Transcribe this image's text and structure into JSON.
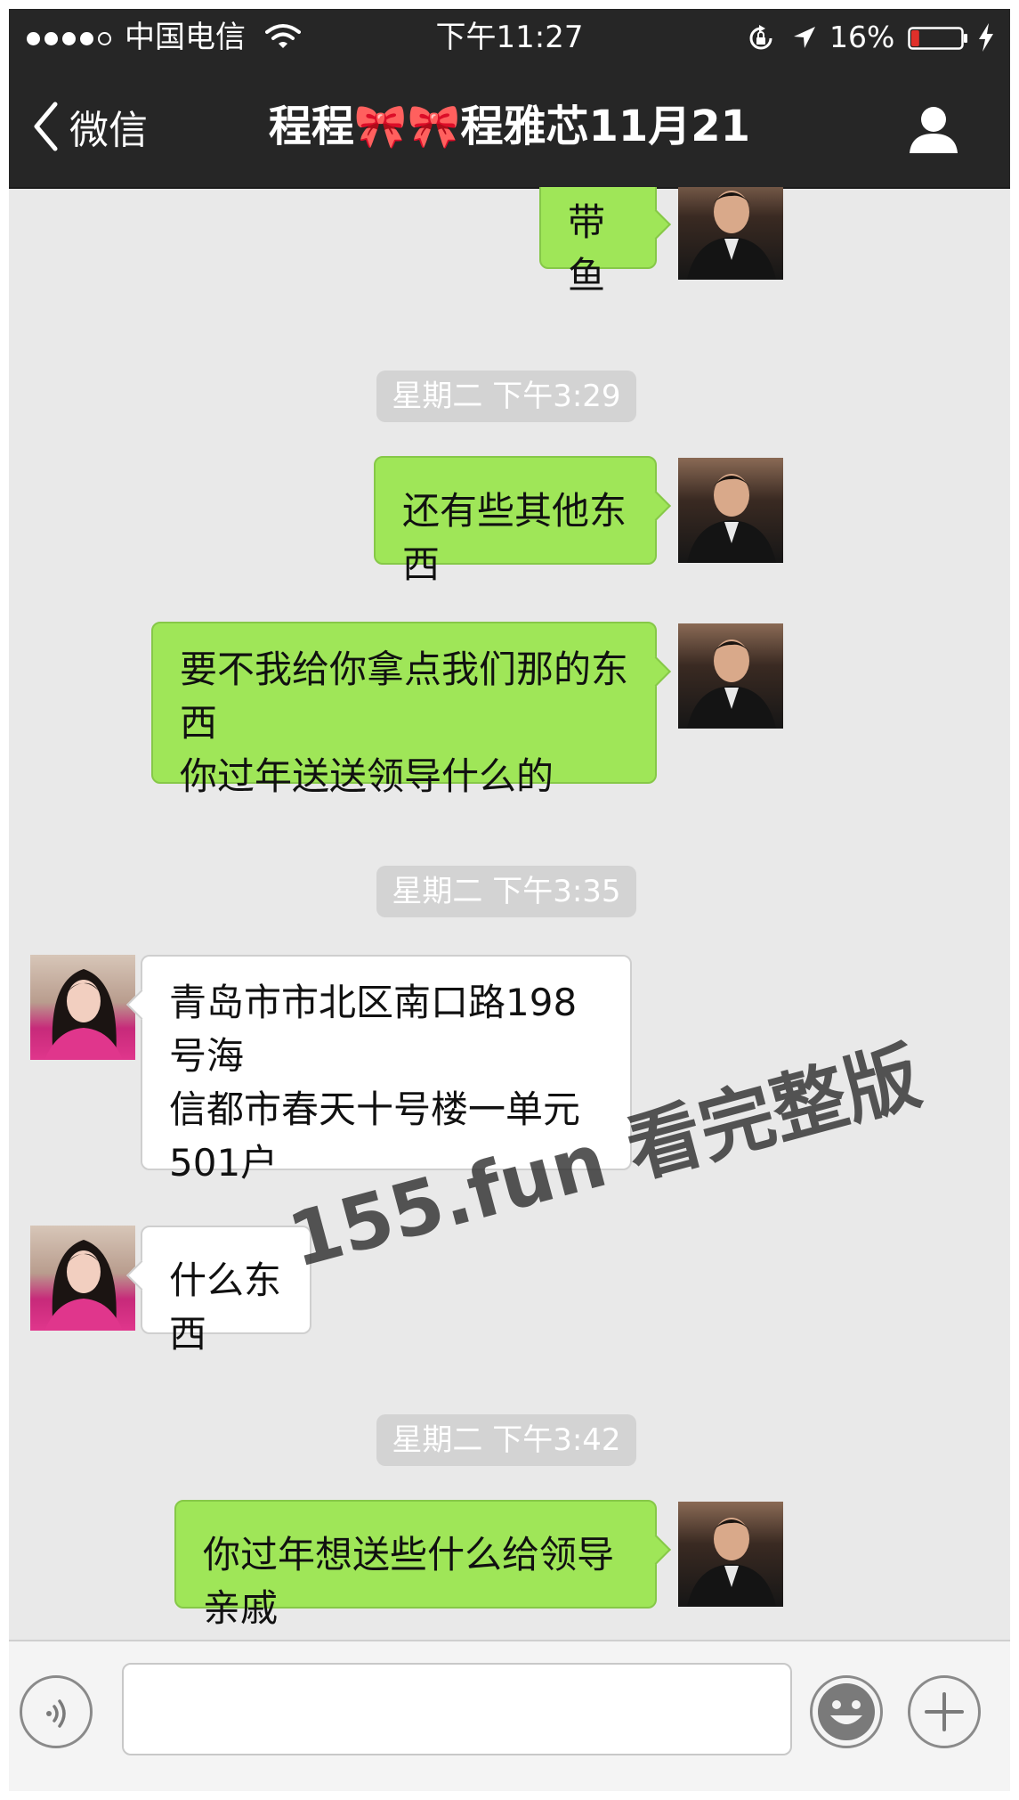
{
  "status_bar": {
    "carrier": "中国电信",
    "time": "下午11:27",
    "battery_percent": "16%",
    "battery_level": 0.16,
    "signal_bars": 4
  },
  "nav": {
    "back_label": "微信",
    "title": "程程🎀🎀程雅芯11月21"
  },
  "messages": [
    {
      "kind": "out",
      "text": "带鱼"
    },
    {
      "kind": "timestamp",
      "text": "星期二 下午3:29"
    },
    {
      "kind": "out",
      "text": "还有些其他东西"
    },
    {
      "kind": "out",
      "text": "要不我给你拿点我们那的东西\n你过年送送领导什么的"
    },
    {
      "kind": "timestamp",
      "text": "星期二 下午3:35"
    },
    {
      "kind": "in",
      "text": "青岛市市北区南口路198号海\n信都市春天十号楼一单元\n501户"
    },
    {
      "kind": "in",
      "text": "什么东西"
    },
    {
      "kind": "timestamp",
      "text": "星期二 下午3:42"
    },
    {
      "kind": "out",
      "text": "你过年想送些什么给领导亲戚"
    }
  ],
  "watermark": "155.fun 看完整版",
  "input": {
    "value": "",
    "placeholder": ""
  },
  "icons": {
    "voice": "voice-icon",
    "emoji": "emoji-icon",
    "add": "plus-icon",
    "profile": "person-icon",
    "back": "chevron-left-icon"
  },
  "colors": {
    "bar_bg": "#262626",
    "chat_bg": "#e9e9e9",
    "outgoing_bubble": "#9fe658",
    "incoming_bubble": "#ffffff",
    "timestamp_bg": "#d3d3d3",
    "battery_low": "#e0302a"
  }
}
